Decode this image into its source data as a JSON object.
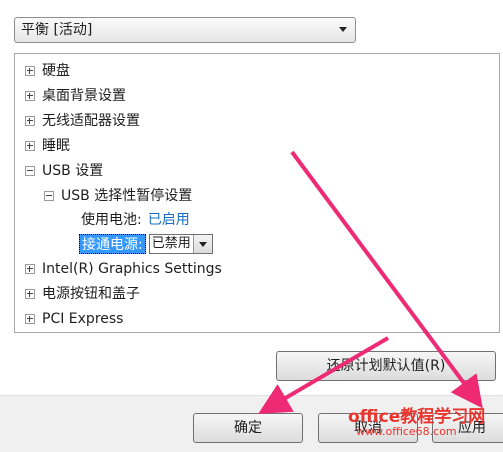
{
  "plan_selector": {
    "value": "平衡 [活动]"
  },
  "tree": {
    "items": [
      {
        "label": "硬盘"
      },
      {
        "label": "桌面背景设置"
      },
      {
        "label": "无线适配器设置"
      },
      {
        "label": "睡眠"
      },
      {
        "label": "USB 设置"
      },
      {
        "label": "USB 选择性暂停设置"
      },
      {
        "label": "使用电池:",
        "value": "已启用"
      },
      {
        "label": "接通电源:",
        "value": "已禁用"
      },
      {
        "label": "Intel(R) Graphics Settings"
      },
      {
        "label": "电源按钮和盖子"
      },
      {
        "label": "PCI Express"
      }
    ]
  },
  "buttons": {
    "restore_defaults": "还原计划默认值(R)",
    "ok": "确定",
    "cancel": "取消",
    "apply": "应用"
  },
  "watermark": {
    "main": "office教程学习网",
    "sub": "www.office68.com"
  },
  "colors": {
    "arrow": "#ee2a74",
    "selection": "#3399ff",
    "link_blue": "#1a6fc4"
  }
}
